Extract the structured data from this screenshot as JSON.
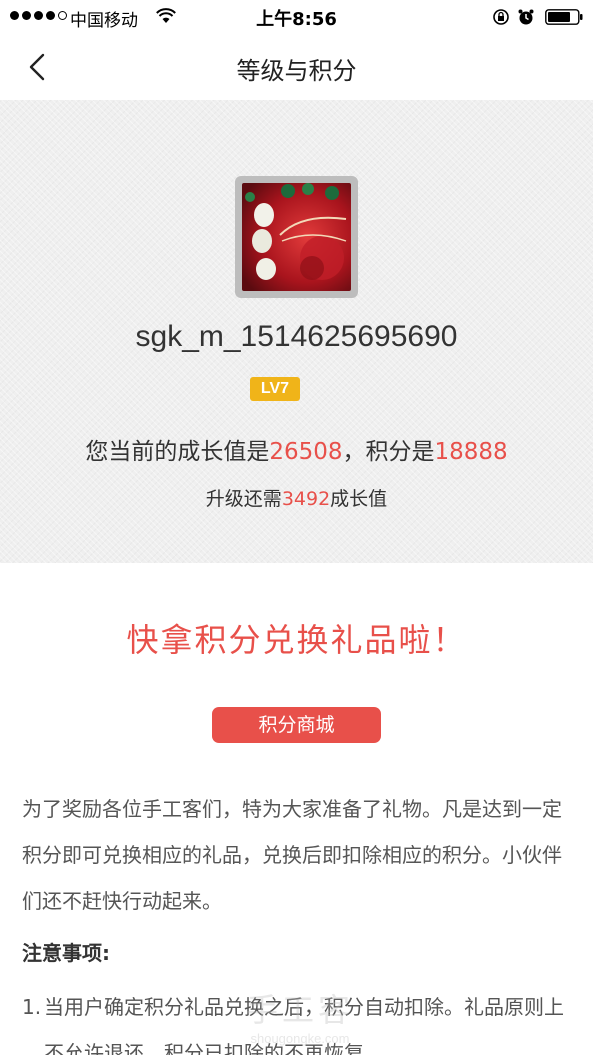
{
  "status_bar": {
    "carrier": "中国移动",
    "time": "上午8:56"
  },
  "nav": {
    "title": "等级与积分"
  },
  "profile": {
    "username": "sgk_m_1514625695690",
    "level_badge": "LV7",
    "growth_prefix": "您当前的成长值是",
    "growth_value": "26508",
    "points_prefix": "，积分是",
    "points_value": "18888",
    "upgrade_prefix": "升级还需",
    "upgrade_value": "3492",
    "upgrade_suffix": "成长值"
  },
  "promo": {
    "title": "快拿积分兑换礼品啦！",
    "button_label": "积分商城",
    "description": "为了奖励各位手工客们，特为大家准备了礼物。凡是达到一定积分即可兑换相应的礼品，兑换后即扣除相应的积分。小伙伴们还不赶快行动起来。"
  },
  "notice": {
    "heading": "注意事项:",
    "items": [
      {
        "num": "1.",
        "text": "当用户确定积分礼品兑换之后，积分自动扣除。礼品原则上不允许退还，积分已扣除的不再恢复。"
      }
    ]
  },
  "watermark": {
    "main": "手工客",
    "sub": "shougongke.com"
  },
  "colors": {
    "accent": "#e8504a",
    "badge": "#f0b419"
  },
  "icons": [
    "back-icon",
    "wifi-icon",
    "rotation-lock-icon",
    "alarm-icon",
    "battery-icon"
  ]
}
